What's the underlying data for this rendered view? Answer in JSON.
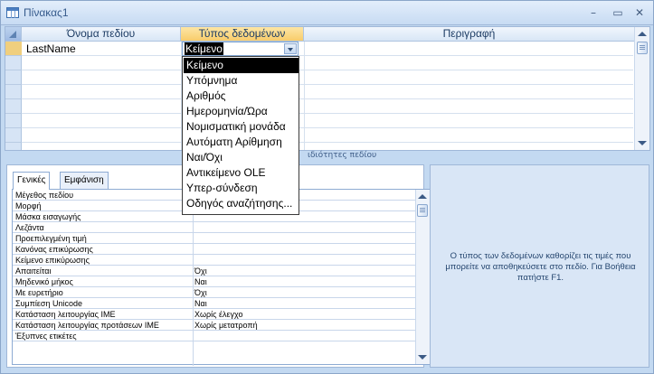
{
  "window": {
    "title": "Πίνακας1",
    "minimize": "–",
    "restore": "▭",
    "close": "✕"
  },
  "columns": [
    "Όνομα πεδίου",
    "Τύπος δεδομένων",
    "Περιγραφή"
  ],
  "rows": [
    {
      "field": "LastName",
      "type": "Κείμενο",
      "description": ""
    }
  ],
  "field_properties_label": "ιδιότητες πεδίου",
  "dropdown": {
    "current": "Κείμενο",
    "options": [
      "Κείμενο",
      "Υπόμνημα",
      "Αριθμός",
      "Ημερομηνία/Ώρα",
      "Νομισματική μονάδα",
      "Αυτόματη Αρίθμηση",
      "Ναι/Όχι",
      "Αντικείμενο OLE",
      "Υπερ-σύνδεση",
      "Οδηγός αναζήτησης..."
    ],
    "selected_index": 0
  },
  "tabs": [
    "Γενικές",
    "Εμφάνιση"
  ],
  "properties": [
    {
      "name": "Μέγεθος πεδίου",
      "value": ""
    },
    {
      "name": "Μορφή",
      "value": ""
    },
    {
      "name": "Μάσκα εισαγωγής",
      "value": ""
    },
    {
      "name": "Λεζάντα",
      "value": ""
    },
    {
      "name": "Προεπιλεγμένη τιμή",
      "value": ""
    },
    {
      "name": "Κανόνας επικύρωσης",
      "value": ""
    },
    {
      "name": "Κείμενο επικύρωσης",
      "value": ""
    },
    {
      "name": "Απαιτείται",
      "value": "Όχι"
    },
    {
      "name": "Μηδενικό μήκος",
      "value": "Ναι"
    },
    {
      "name": "Με ευρετήριο",
      "value": "Όχι"
    },
    {
      "name": "Συμπίεση Unicode",
      "value": "Ναι"
    },
    {
      "name": "Κατάσταση λειτουργίας IME",
      "value": "Χωρίς έλεγχο"
    },
    {
      "name": "Κατάσταση λειτουργίας προτάσεων IME",
      "value": "Χωρίς μετατροπή"
    },
    {
      "name": "Έξυπνες ετικέτες",
      "value": ""
    }
  ],
  "help": {
    "text": "Ο τύπος των δεδομένων καθορίζει τις τιμές που μπορείτε να αποθηκεύσετε στο πεδίο. Για Βοήθεια πατήστε F1."
  },
  "colors": {
    "frame": "#c3d9f1",
    "header": "#d8e6f6",
    "selected_header": "#f8cc6b",
    "help_bg": "#d9e6f6"
  }
}
